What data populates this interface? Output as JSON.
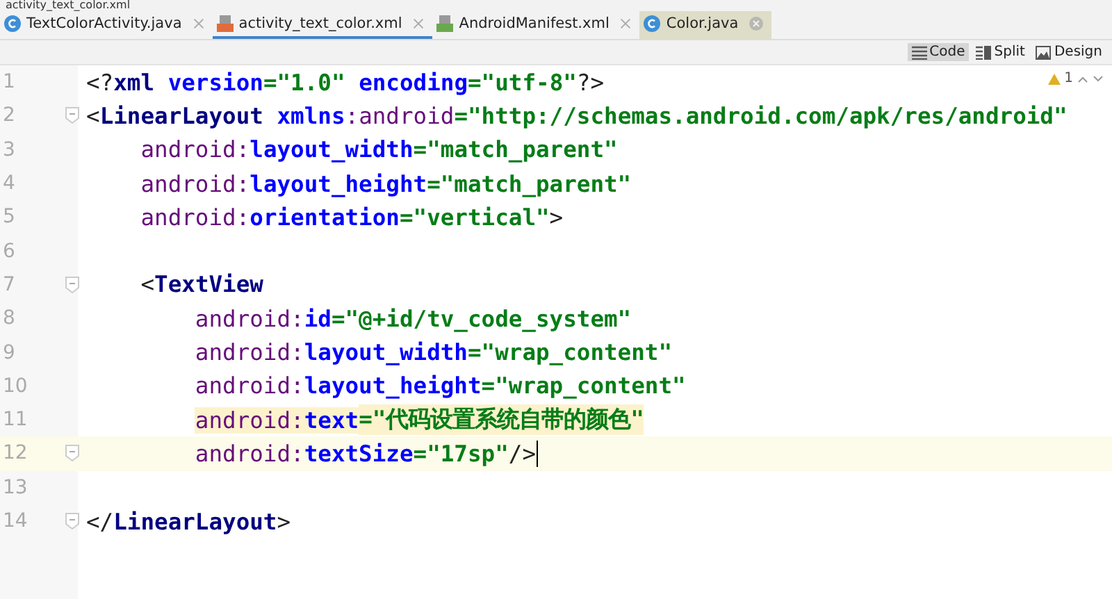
{
  "window": {
    "title": "activity_text_color.xml"
  },
  "tabs": [
    {
      "label": "TextColorActivity.java",
      "kind": "java",
      "selected": false,
      "hovered": false
    },
    {
      "label": "activity_text_color.xml",
      "kind": "xml",
      "selected": true,
      "hovered": false
    },
    {
      "label": "AndroidManifest.xml",
      "kind": "manifest",
      "selected": false,
      "hovered": false
    },
    {
      "label": "Color.java",
      "kind": "java",
      "selected": false,
      "hovered": true
    }
  ],
  "view_modes": [
    {
      "label": "Code",
      "kind": "code",
      "selected": true
    },
    {
      "label": "Split",
      "kind": "split",
      "selected": false
    },
    {
      "label": "Design",
      "kind": "design",
      "selected": false
    }
  ],
  "warnings": {
    "count": "1"
  },
  "lines": [
    {
      "number": "1",
      "fold": false,
      "current": false,
      "tokens": [
        {
          "kind": "punct",
          "text": "<?"
        },
        {
          "kind": "tag",
          "text": "xml "
        },
        {
          "kind": "attr",
          "text": "version"
        },
        {
          "kind": "value",
          "text": "=\"1.0\" "
        },
        {
          "kind": "attr",
          "text": "encoding"
        },
        {
          "kind": "value",
          "text": "=\"utf-8\""
        },
        {
          "kind": "punct",
          "text": "?>"
        }
      ]
    },
    {
      "number": "2",
      "fold": true,
      "current": false,
      "tokens": [
        {
          "kind": "punct",
          "text": "<"
        },
        {
          "kind": "tag",
          "text": "LinearLayout "
        },
        {
          "kind": "attr",
          "text": "xmlns"
        },
        {
          "kind": "ns",
          "text": ":android"
        },
        {
          "kind": "value",
          "text": "=\"http://schemas.android.com/apk/res/android\""
        }
      ]
    },
    {
      "number": "3",
      "fold": false,
      "current": false,
      "tokens": [
        {
          "kind": "ns",
          "text": "    android:"
        },
        {
          "kind": "attr",
          "text": "layout_width"
        },
        {
          "kind": "value",
          "text": "=\"match_parent\""
        }
      ]
    },
    {
      "number": "4",
      "fold": false,
      "current": false,
      "tokens": [
        {
          "kind": "ns",
          "text": "    android:"
        },
        {
          "kind": "attr",
          "text": "layout_height"
        },
        {
          "kind": "value",
          "text": "=\"match_parent\""
        }
      ]
    },
    {
      "number": "5",
      "fold": false,
      "current": false,
      "tokens": [
        {
          "kind": "ns",
          "text": "    android:"
        },
        {
          "kind": "attr",
          "text": "orientation"
        },
        {
          "kind": "value",
          "text": "=\"vertical\""
        },
        {
          "kind": "punct",
          "text": ">"
        }
      ]
    },
    {
      "number": "6",
      "fold": false,
      "current": false
    },
    {
      "number": "7",
      "fold": true,
      "current": false,
      "tokens": [
        {
          "kind": "punct",
          "text": "    <"
        },
        {
          "kind": "tag",
          "text": "TextView"
        }
      ]
    },
    {
      "number": "8",
      "fold": false,
      "current": false,
      "tokens": [
        {
          "kind": "ns",
          "text": "        android:"
        },
        {
          "kind": "attr",
          "text": "id"
        },
        {
          "kind": "value",
          "text": "=\"@+id/tv_code_system\""
        }
      ]
    },
    {
      "number": "9",
      "fold": false,
      "current": false,
      "tokens": [
        {
          "kind": "ns",
          "text": "        android:"
        },
        {
          "kind": "attr",
          "text": "layout_width"
        },
        {
          "kind": "value",
          "text": "=\"wrap_content\""
        }
      ]
    },
    {
      "number": "10",
      "fold": false,
      "current": false,
      "tokens": [
        {
          "kind": "ns",
          "text": "        android:"
        },
        {
          "kind": "attr",
          "text": "layout_height"
        },
        {
          "kind": "value",
          "text": "=\"wrap_content\""
        }
      ]
    },
    {
      "number": "11",
      "fold": false,
      "current": false,
      "tokens": [
        {
          "kind": "ns",
          "text": "        android:",
          "highlighted": true
        },
        {
          "kind": "attr",
          "text": "text",
          "highlighted": true
        },
        {
          "kind": "value",
          "text": "=\"代码设置系统自带的颜色\"",
          "highlighted": true
        }
      ]
    },
    {
      "number": "12",
      "fold": true,
      "current": true,
      "tokens": [
        {
          "kind": "ns",
          "text": "        android:"
        },
        {
          "kind": "attr",
          "text": "textSize"
        },
        {
          "kind": "value",
          "text": "=\"17sp\""
        },
        {
          "kind": "punct",
          "text": "/>"
        }
      ]
    },
    {
      "number": "13",
      "fold": false,
      "current": false
    },
    {
      "number": "14",
      "fold": true,
      "current": false,
      "tokens": [
        {
          "kind": "punct",
          "text": "</"
        },
        {
          "kind": "tag",
          "text": "LinearLayout"
        },
        {
          "kind": "punct",
          "text": ">"
        }
      ]
    }
  ]
}
